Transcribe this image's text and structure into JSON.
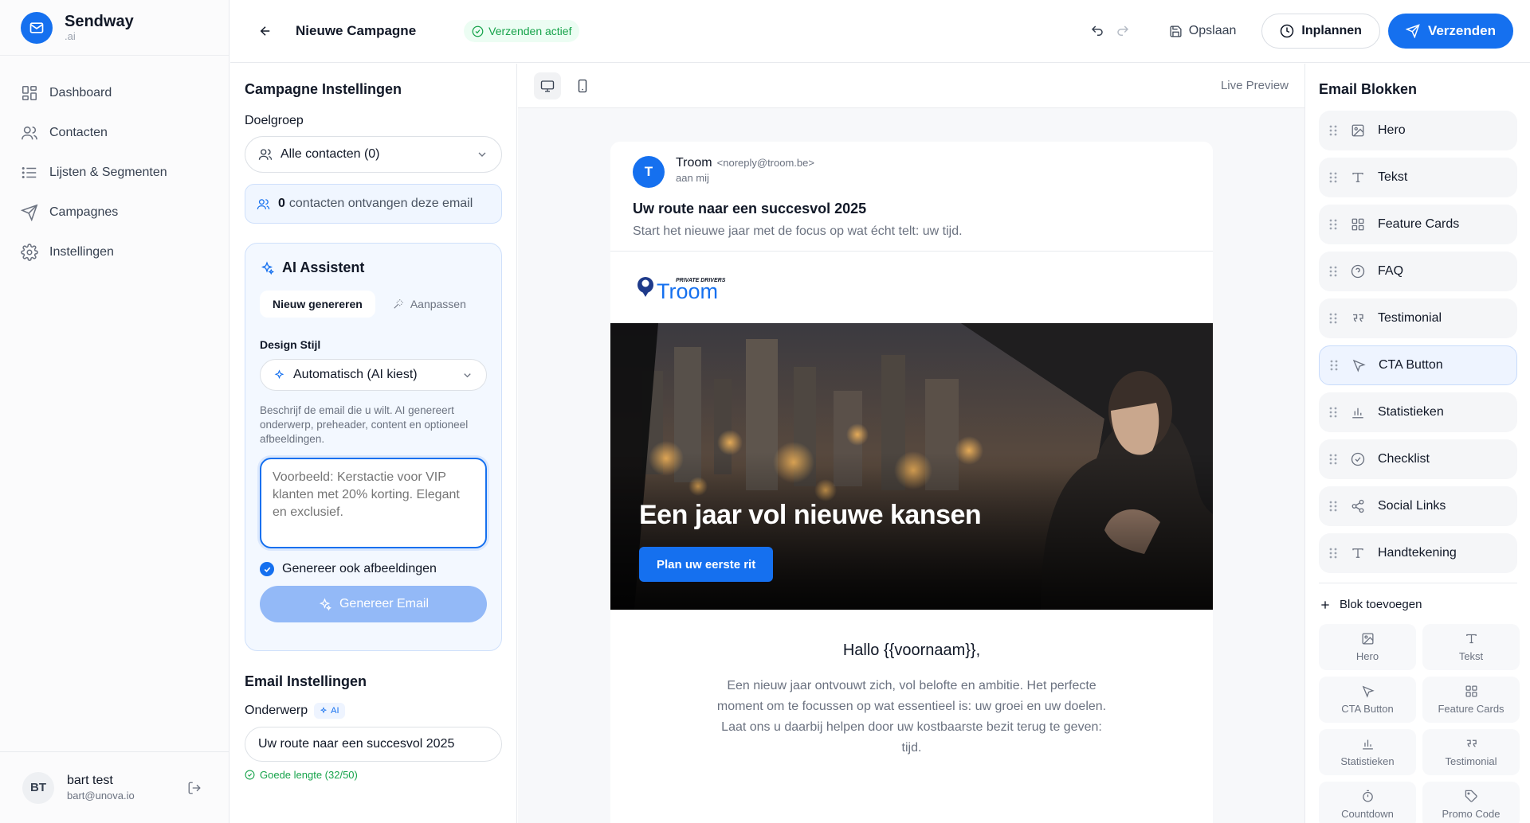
{
  "app": {
    "name": "Sendway",
    "sub": ".ai"
  },
  "sidebar": {
    "items": [
      {
        "label": "Dashboard",
        "icon": "grid-icon"
      },
      {
        "label": "Contacten",
        "icon": "users-icon"
      },
      {
        "label": "Lijsten & Segmenten",
        "icon": "list-icon"
      },
      {
        "label": "Campagnes",
        "icon": "send-icon"
      },
      {
        "label": "Instellingen",
        "icon": "gear-icon"
      }
    ]
  },
  "user": {
    "initials": "BT",
    "name": "bart test",
    "email": "bart@unova.io"
  },
  "topbar": {
    "title": "Nieuwe Campagne",
    "status": "Verzenden actief",
    "save": "Opslaan",
    "schedule": "Inplannen",
    "send": "Verzenden"
  },
  "settings": {
    "title": "Campagne Instellingen",
    "audience_label": "Doelgroep",
    "audience_value": "Alle contacten (0)",
    "recipients_count": "0",
    "recipients_text": "contacten ontvangen deze email",
    "ai": {
      "title": "AI Assistent",
      "tab_new": "Nieuw genereren",
      "tab_edit": "Aanpassen",
      "style_label": "Design Stijl",
      "style_value": "Automatisch (AI kiest)",
      "hint": "Beschrijf de email die u wilt. AI genereert onderwerp, preheader, content en optioneel afbeeldingen.",
      "prompt_placeholder": "Voorbeeld: Kerstactie voor VIP klanten met 20% korting. Elegant en exclusief.",
      "images_label": "Genereer ook afbeeldingen",
      "generate_label": "Genereer Email"
    },
    "email_settings_title": "Email Instellingen",
    "subject_label": "Onderwerp",
    "subject_badge": "AI",
    "subject_value": "Uw route naar een succesvol 2025",
    "subject_status": "Goede lengte (32/50)"
  },
  "preview": {
    "live_label": "Live Preview",
    "sender_initial": "T",
    "sender_name": "Troom",
    "sender_address": "<noreply@troom.be>",
    "to": "aan mij",
    "subject": "Uw route naar een succesvol 2025",
    "preheader": "Start het nieuwe jaar met de focus op wat écht telt: uw tijd.",
    "logo_tagline": "PRIVATE DRIVERS",
    "logo_text": "Troom",
    "hero_title": "Een jaar vol nieuwe kansen",
    "hero_cta": "Plan uw eerste rit",
    "greeting": "Hallo {{voornaam}},",
    "body": "Een nieuw jaar ontvouwt zich, vol belofte en ambitie. Het perfecte moment om te focussen op wat essentieel is: uw groei en uw doelen. Laat ons u daarbij helpen door uw kostbaarste bezit terug te geven: tijd."
  },
  "blocks": {
    "title": "Email Blokken",
    "items": [
      {
        "label": "Hero",
        "icon": "image-icon"
      },
      {
        "label": "Tekst",
        "icon": "text-icon"
      },
      {
        "label": "Feature Cards",
        "icon": "grid-icon"
      },
      {
        "label": "FAQ",
        "icon": "help-circle-icon"
      },
      {
        "label": "Testimonial",
        "icon": "quote-icon"
      },
      {
        "label": "CTA Button",
        "icon": "pointer-icon"
      },
      {
        "label": "Statistieken",
        "icon": "bar-chart-icon"
      },
      {
        "label": "Checklist",
        "icon": "check-circle-icon"
      },
      {
        "label": "Social Links",
        "icon": "share-icon"
      },
      {
        "label": "Handtekening",
        "icon": "text-icon"
      }
    ],
    "add_label": "Blok toevoegen",
    "grid": [
      {
        "label": "Hero",
        "icon": "image-icon"
      },
      {
        "label": "Tekst",
        "icon": "text-icon"
      },
      {
        "label": "CTA Button",
        "icon": "pointer-icon"
      },
      {
        "label": "Feature Cards",
        "icon": "grid-icon"
      },
      {
        "label": "Statistieken",
        "icon": "bar-chart-icon"
      },
      {
        "label": "Testimonial",
        "icon": "quote-icon"
      },
      {
        "label": "Countdown",
        "icon": "timer-icon"
      },
      {
        "label": "Promo Code",
        "icon": "tag-icon"
      }
    ]
  },
  "colors": {
    "accent": "#1570ef",
    "success": "#16a34a"
  }
}
